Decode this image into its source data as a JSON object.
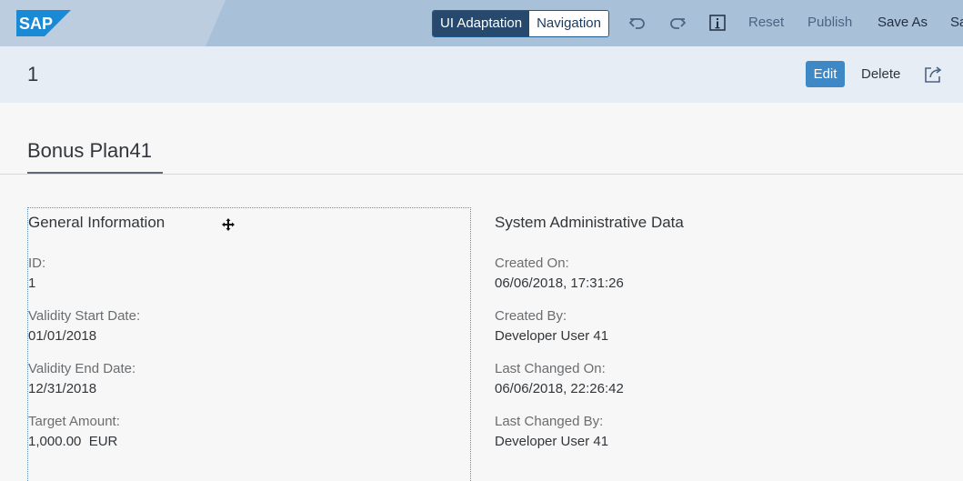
{
  "toolbar": {
    "logo_text": "SAP",
    "mode_ui_adaptation": "UI Adaptation",
    "mode_navigation": "Navigation",
    "undo_icon": "undo-icon",
    "redo_icon": "redo-icon",
    "info_icon": "info-icon",
    "reset": "Reset",
    "publish": "Publish",
    "save_as": "Save As",
    "save_truncated": "Sa"
  },
  "header": {
    "title": "1",
    "edit": "Edit",
    "delete": "Delete",
    "share_icon": "share-icon"
  },
  "page": {
    "section_title": "Bonus Plan41"
  },
  "general": {
    "title": "General Information",
    "fields": [
      {
        "label": "ID:",
        "value": "1"
      },
      {
        "label": "Validity Start Date:",
        "value": "01/01/2018"
      },
      {
        "label": "Validity End Date:",
        "value": "12/31/2018"
      },
      {
        "label": "Target Amount:",
        "value": "1,000.00  EUR"
      }
    ]
  },
  "admin": {
    "title": "System Administrative Data",
    "fields": [
      {
        "label": "Created On:",
        "value": "06/06/2018, 17:31:26"
      },
      {
        "label": "Created By:",
        "value": "Developer User 41"
      },
      {
        "label": "Last Changed On:",
        "value": "06/06/2018, 22:26:42"
      },
      {
        "label": "Last Changed By:",
        "value": "Developer User 41"
      }
    ]
  },
  "colors": {
    "toolbar_bg": "#a9c0d9",
    "accent": "#3e88c6",
    "active_segment": "#27496d"
  }
}
